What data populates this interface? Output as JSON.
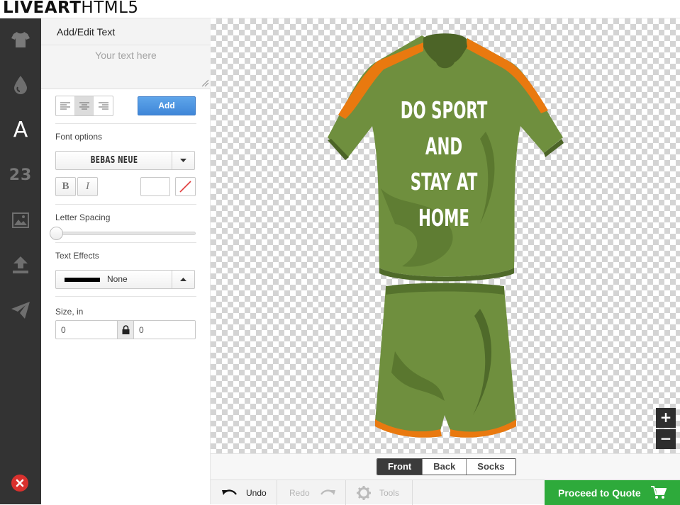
{
  "app": {
    "logo_bold": "LIVEART",
    "logo_light": "HTML5"
  },
  "sidebar": {
    "items": [
      {
        "id": "products",
        "icon": "tshirt-icon"
      },
      {
        "id": "colors",
        "icon": "drop-icon"
      },
      {
        "id": "text",
        "icon": "text-a-icon",
        "glyph": "A",
        "active": true
      },
      {
        "id": "names-numbers",
        "icon": "numbers-icon",
        "glyph": "23"
      },
      {
        "id": "images",
        "icon": "image-icon"
      },
      {
        "id": "upload",
        "icon": "upload-icon"
      },
      {
        "id": "share",
        "icon": "paper-plane-icon"
      }
    ],
    "close_icon": "close-icon"
  },
  "panel": {
    "title": "Add/Edit Text",
    "text_placeholder": "Your text here",
    "text_value": "",
    "align_options": [
      "left",
      "center",
      "right"
    ],
    "align_selected": "center",
    "add_label": "Add",
    "font_options_label": "Font options",
    "font_value": "BEBAS NEUE",
    "bold_label": "B",
    "italic_label": "I",
    "letter_spacing_label": "Letter Spacing",
    "letter_spacing_value": 0,
    "text_effects_label": "Text Effects",
    "text_effect_value": "None",
    "size_label": "Size, in",
    "size_width": "0",
    "size_height": "0"
  },
  "canvas": {
    "design_text_lines": [
      "DO SPORT",
      "AND",
      "STAY AT",
      "HOME"
    ],
    "product_colors": {
      "body": "#6f8f3e",
      "dark": "#4f6a2a",
      "accent": "#e9790f"
    },
    "zoom_in_label": "+",
    "zoom_out_label": "−"
  },
  "views": {
    "tabs": [
      "Front",
      "Back",
      "Socks"
    ],
    "active": "Front"
  },
  "toolbar": {
    "undo_label": "Undo",
    "redo_label": "Redo",
    "tools_label": "Tools",
    "quote_label": "Proceed to Quote"
  },
  "colors": {
    "accent_blue": "#4a90e2",
    "quote_green": "#2eaa3b",
    "sidebar_bg": "#333333"
  }
}
